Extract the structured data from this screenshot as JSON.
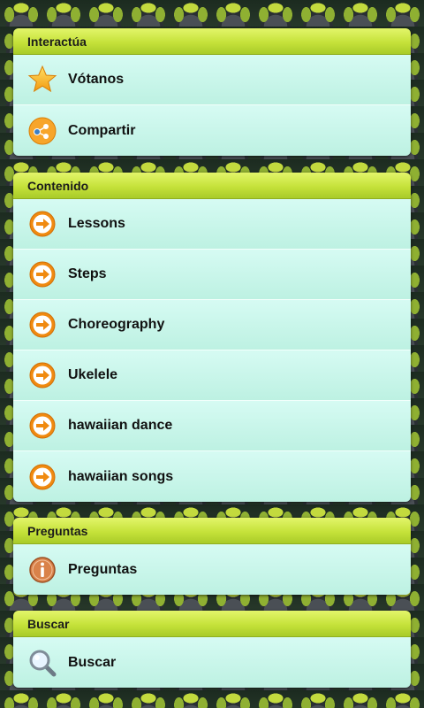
{
  "sections": [
    {
      "header": "Interactúa",
      "items": [
        {
          "label": "Vótanos",
          "icon": "star-icon"
        },
        {
          "label": "Compartir",
          "icon": "share-icon"
        }
      ]
    },
    {
      "header": "Contenido",
      "items": [
        {
          "label": "Lessons",
          "icon": "arrow-right-icon"
        },
        {
          "label": "Steps",
          "icon": "arrow-right-icon"
        },
        {
          "label": "Choreography",
          "icon": "arrow-right-icon"
        },
        {
          "label": "Ukelele",
          "icon": "arrow-right-icon"
        },
        {
          "label": "hawaiian dance",
          "icon": "arrow-right-icon"
        },
        {
          "label": "hawaiian songs",
          "icon": "arrow-right-icon"
        }
      ]
    },
    {
      "header": "Preguntas",
      "items": [
        {
          "label": "Preguntas",
          "icon": "info-icon"
        }
      ]
    },
    {
      "header": "Buscar",
      "items": [
        {
          "label": "Buscar",
          "icon": "search-icon"
        }
      ]
    }
  ],
  "colors": {
    "header_accent": "#c5e23a",
    "row_background": "#c9f5ea",
    "arrow_orange": "#f08a10"
  }
}
